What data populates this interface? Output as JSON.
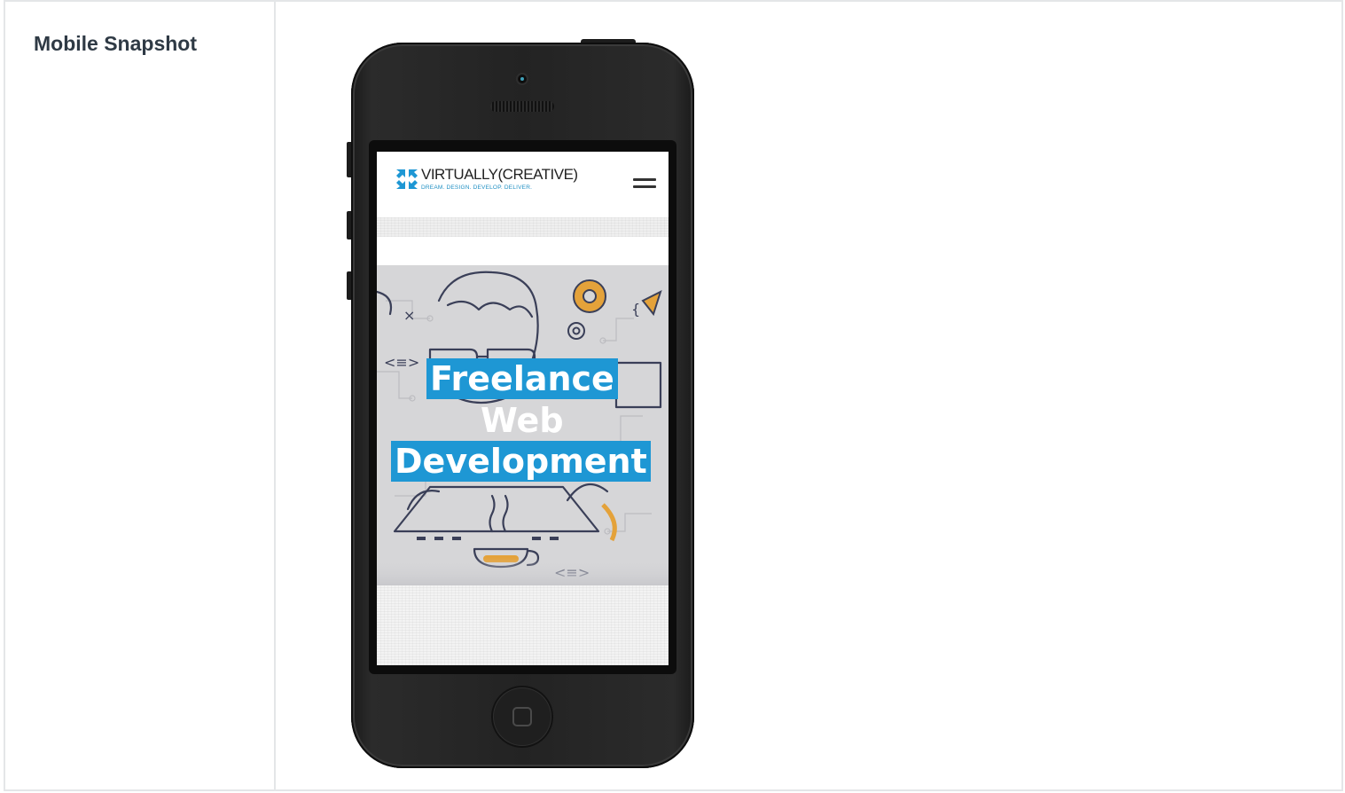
{
  "report": {
    "label": "Mobile Snapshot"
  },
  "site": {
    "logo_wordmark": "VIRTUALLY(CREATIVE)",
    "logo_tagline": "DREAM. DESIGN. DEVELOP. DELIVER.",
    "menu_icon": "hamburger-menu-icon",
    "hero_lines": [
      "Freelance",
      "Web",
      "Development"
    ]
  },
  "colors": {
    "brand_blue": "#1e97d4",
    "label_text": "#2f3a45",
    "phone_body": "#232323"
  }
}
